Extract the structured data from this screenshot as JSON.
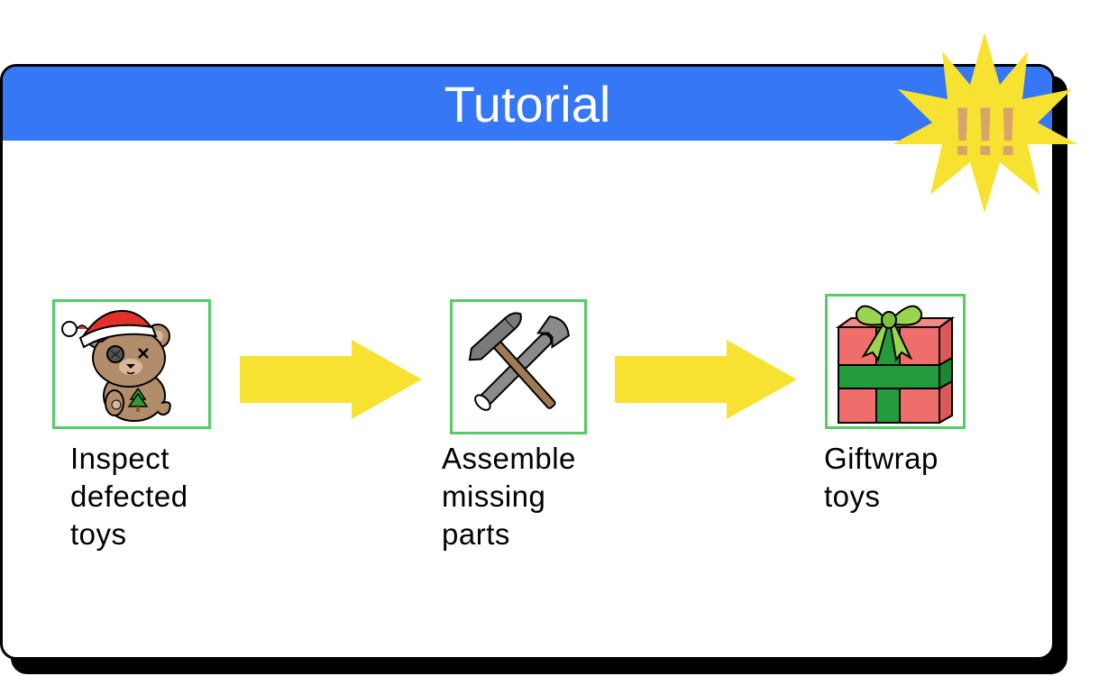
{
  "tutorial": {
    "title": "Tutorial",
    "burst_text": "!!!",
    "colors": {
      "header": "#3577f4",
      "card_border": "#55cc66",
      "arrow": "#f7e231",
      "burst": "#f7e231",
      "burst_text": "#d9a46a"
    },
    "steps": [
      {
        "label": "Inspect\ndefected\ntoys",
        "icon": "teddy-bear-icon"
      },
      {
        "label": "Assemble\nmissing\nparts",
        "icon": "hammer-wrench-icon"
      },
      {
        "label": "Giftwrap\ntoys",
        "icon": "gift-box-icon"
      }
    ]
  }
}
